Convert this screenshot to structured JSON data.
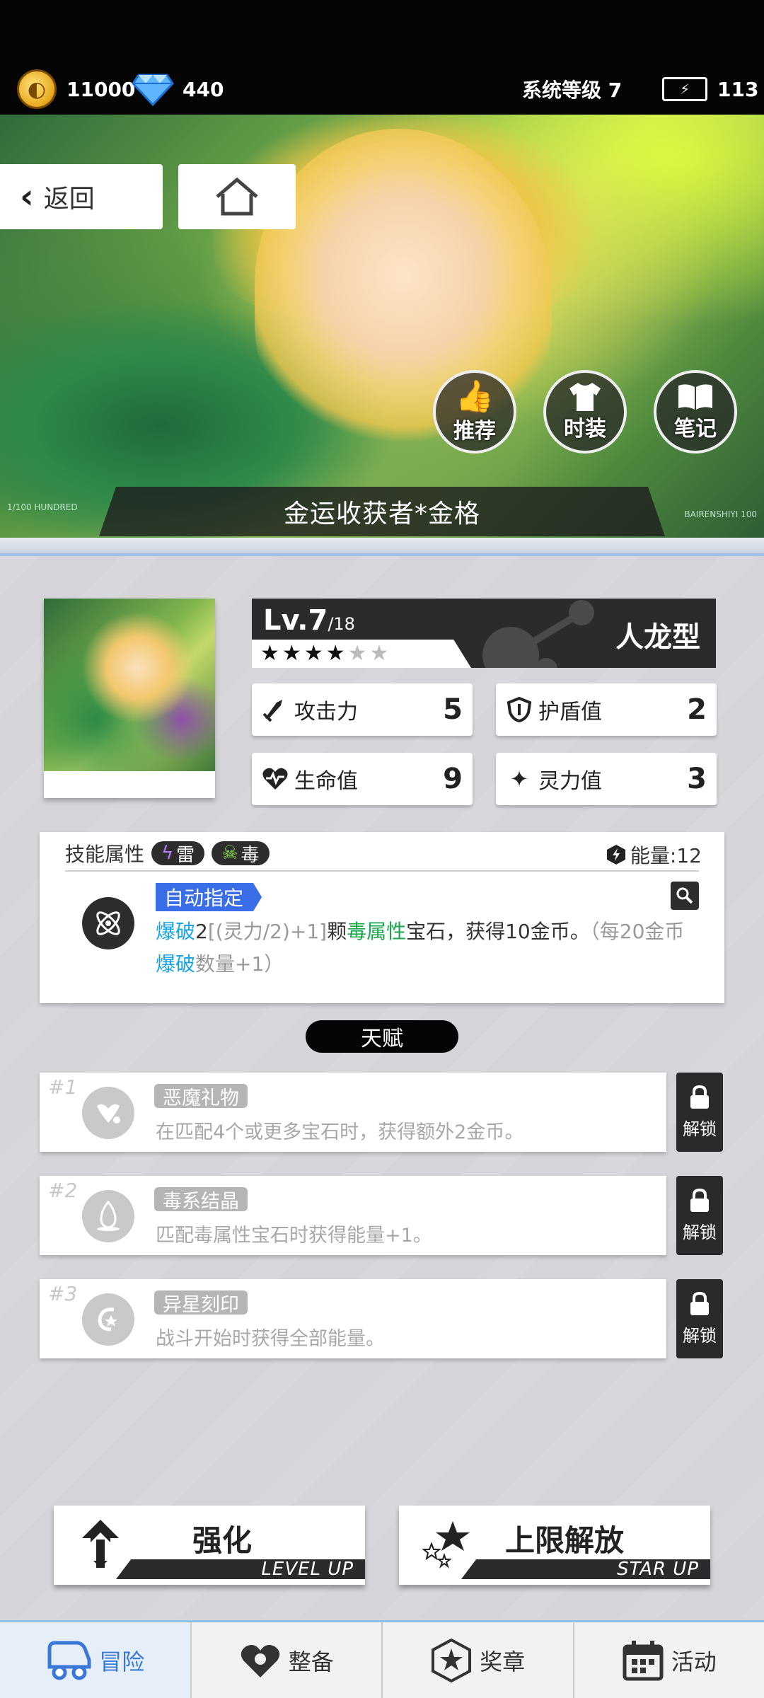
{
  "top_bar": {
    "gold": "11000",
    "gems": "440",
    "system_level": "系统等级 7",
    "energy": "113"
  },
  "hero": {
    "back_label": "返回",
    "buttons": [
      "推荐",
      "时装",
      "笔记"
    ],
    "character_name": "金运收获者*金格",
    "tag_left": "1/100 HUNDRED",
    "tag_right": "BAIRENSHIYI 100"
  },
  "character": {
    "level": "Lv.7",
    "level_max": "/18",
    "stars_filled": 4,
    "stars_total": 6,
    "type": "人龙型",
    "stats": {
      "attack_label": "攻击力",
      "attack": "5",
      "shield_label": "护盾值",
      "shield": "2",
      "hp_label": "生命值",
      "hp": "9",
      "spirit_label": "灵力值",
      "spirit": "3"
    }
  },
  "skill": {
    "title": "技能属性",
    "elements": [
      "雷",
      "毒"
    ],
    "energy": "能量:12",
    "auto_tag": "自动指定",
    "desc": {
      "p1": "爆破",
      "p2": "2",
      "p3": "[(灵力/2)+1]",
      "p4": "颗",
      "p5": "毒属性",
      "p6": "宝石，获得10金币。",
      "p7": "（每20金币",
      "p8": "爆破",
      "p9": "数量+1）"
    }
  },
  "talents": {
    "title": "天赋",
    "unlock_label": "解锁",
    "items": [
      {
        "num": "#1",
        "name": "恶魔礼物",
        "desc": "在匹配4个或更多宝石时，获得额外2金币。"
      },
      {
        "num": "#2",
        "name": "毒系结晶",
        "desc": "匹配毒属性宝石时获得能量+1。"
      },
      {
        "num": "#3",
        "name": "异星刻印",
        "desc": "战斗开始时获得全部能量。"
      }
    ]
  },
  "actions": {
    "enhance": "强化",
    "enhance_sub": "LEVEL UP",
    "limit": "上限解放",
    "limit_sub": "STAR UP"
  },
  "nav": [
    "冒险",
    "整备",
    "奖章",
    "活动"
  ],
  "colors": {
    "accent_blue": "#3a6ee8",
    "highlight_blue": "#17a4e6",
    "highlight_green": "#17a64b",
    "dark": "#2b2b2b"
  }
}
